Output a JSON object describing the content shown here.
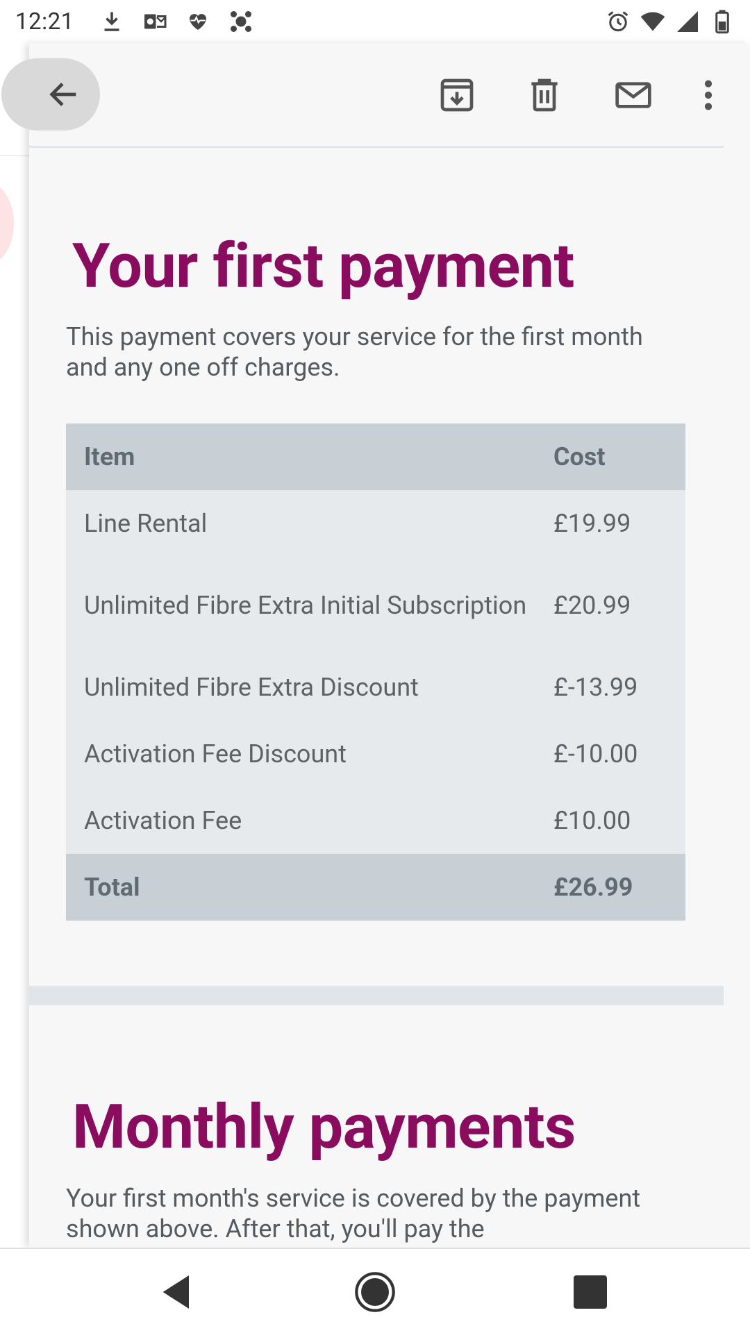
{
  "status_bar": {
    "time": "12:21",
    "left_icons": [
      "download-icon",
      "outlook-icon",
      "health-icon",
      "app-icon"
    ],
    "right_icons": [
      "alarm-icon",
      "wifi-icon",
      "signal-icon",
      "battery-icon"
    ]
  },
  "toolbar": {
    "actions": [
      "archive-icon",
      "delete-icon",
      "mark-unread-icon",
      "more-options-icon"
    ]
  },
  "email": {
    "section1": {
      "heading": "Your first payment",
      "paragraph": "This payment covers your service for the first month and any one off charges.",
      "table": {
        "headers": {
          "item": "Item",
          "cost": "Cost"
        },
        "rows": [
          {
            "item": "Line Rental",
            "cost": "£19.99"
          },
          {
            "item": "Unlimited Fibre Extra Initial Subscription",
            "cost": "£20.99"
          },
          {
            "item": "Unlimited Fibre Extra Discount",
            "cost": "£-13.99"
          },
          {
            "item": "Activation Fee Discount",
            "cost": "£-10.00"
          },
          {
            "item": "Activation Fee",
            "cost": "£10.00"
          }
        ],
        "total": {
          "label": "Total",
          "cost": "£26.99"
        }
      }
    },
    "section2": {
      "heading": "Monthly payments",
      "paragraph": "Your first month's service is covered by the payment shown above. After that, you'll pay the"
    }
  },
  "colors": {
    "heading": "#8a0c5f",
    "table_header": "#c8d0d6",
    "table_row": "#e6eaed"
  }
}
